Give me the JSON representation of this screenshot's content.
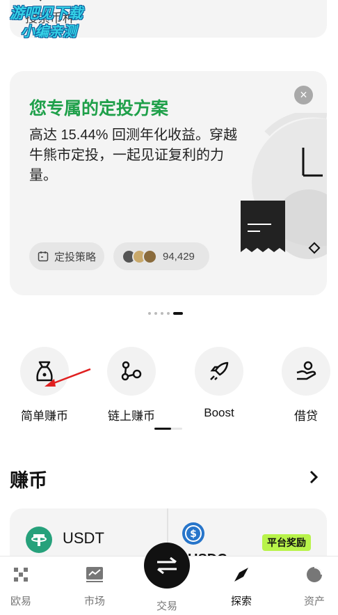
{
  "search": {
    "placeholder": "搜索币种"
  },
  "watermark": {
    "line1": "游吧见下载",
    "line2": "小编亲测"
  },
  "promo": {
    "title": "您专属的定投方案",
    "body": "高达 15.44% 回测年化收益。穿越牛熊市定投，一起见证复利的力量。",
    "close_label": "×",
    "strategy_chip": "定投策略",
    "users_count": "94,429"
  },
  "pager": {
    "total": 5,
    "active_index": 4
  },
  "features": [
    {
      "label": "简单赚币",
      "icon": "money-bag-icon"
    },
    {
      "label": "链上赚币",
      "icon": "chain-icon"
    },
    {
      "label": "Boost",
      "icon": "rocket-icon"
    },
    {
      "label": "借贷",
      "icon": "loan-hand-icon"
    }
  ],
  "earn": {
    "title": "赚币",
    "usdt_label": "USDT",
    "usdc_partial": "USDC",
    "reward_badge": "平台奖励",
    "colors": {
      "usdt": "#26a17b",
      "usdc": "#2775ca",
      "badge": "#b8f34a"
    }
  },
  "nav": {
    "items": [
      {
        "label": "欧易",
        "icon": "okx-logo-icon"
      },
      {
        "label": "市场",
        "icon": "chart-icon"
      },
      {
        "label": "交易",
        "icon": "swap-icon"
      },
      {
        "label": "探索",
        "icon": "compass-icon",
        "active": true
      },
      {
        "label": "资产",
        "icon": "pie-chart-icon"
      }
    ]
  },
  "colors": {
    "accent_green": "#1fa04a",
    "text": "#111111"
  }
}
